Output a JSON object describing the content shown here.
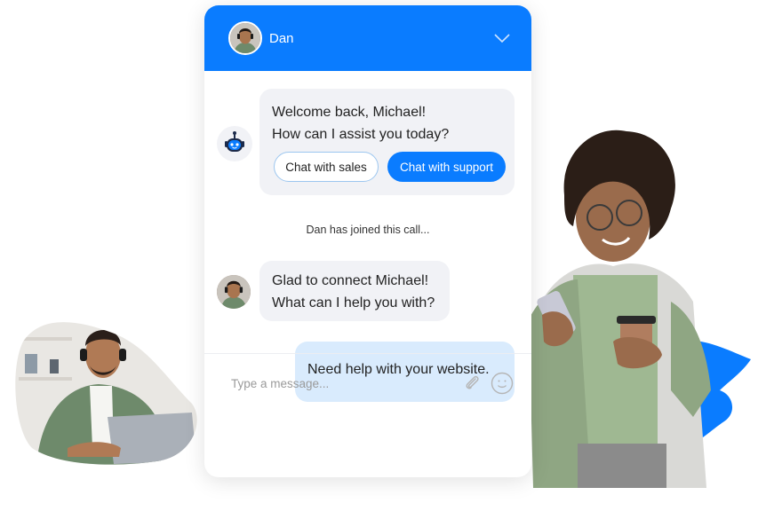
{
  "header": {
    "agent_name": "Dan",
    "accent_color": "#0a7cff"
  },
  "messages": {
    "bot_greeting_line1": "Welcome back, Michael!",
    "bot_greeting_line2": "How can I assist you today?",
    "quick_replies": [
      {
        "label": "Chat with sales"
      },
      {
        "label": "Chat with support"
      }
    ],
    "system_notice": "Dan has joined this call...",
    "agent_line1": "Glad to connect Michael!",
    "agent_line2": "What can I help you with?",
    "user_message": "Need help with your website."
  },
  "composer": {
    "placeholder": "Type a message...",
    "value": ""
  },
  "icons": {
    "header_toggle": "chevron-down-icon",
    "bot": "robot-icon",
    "attach": "paperclip-icon",
    "emoji": "smiley-icon"
  }
}
